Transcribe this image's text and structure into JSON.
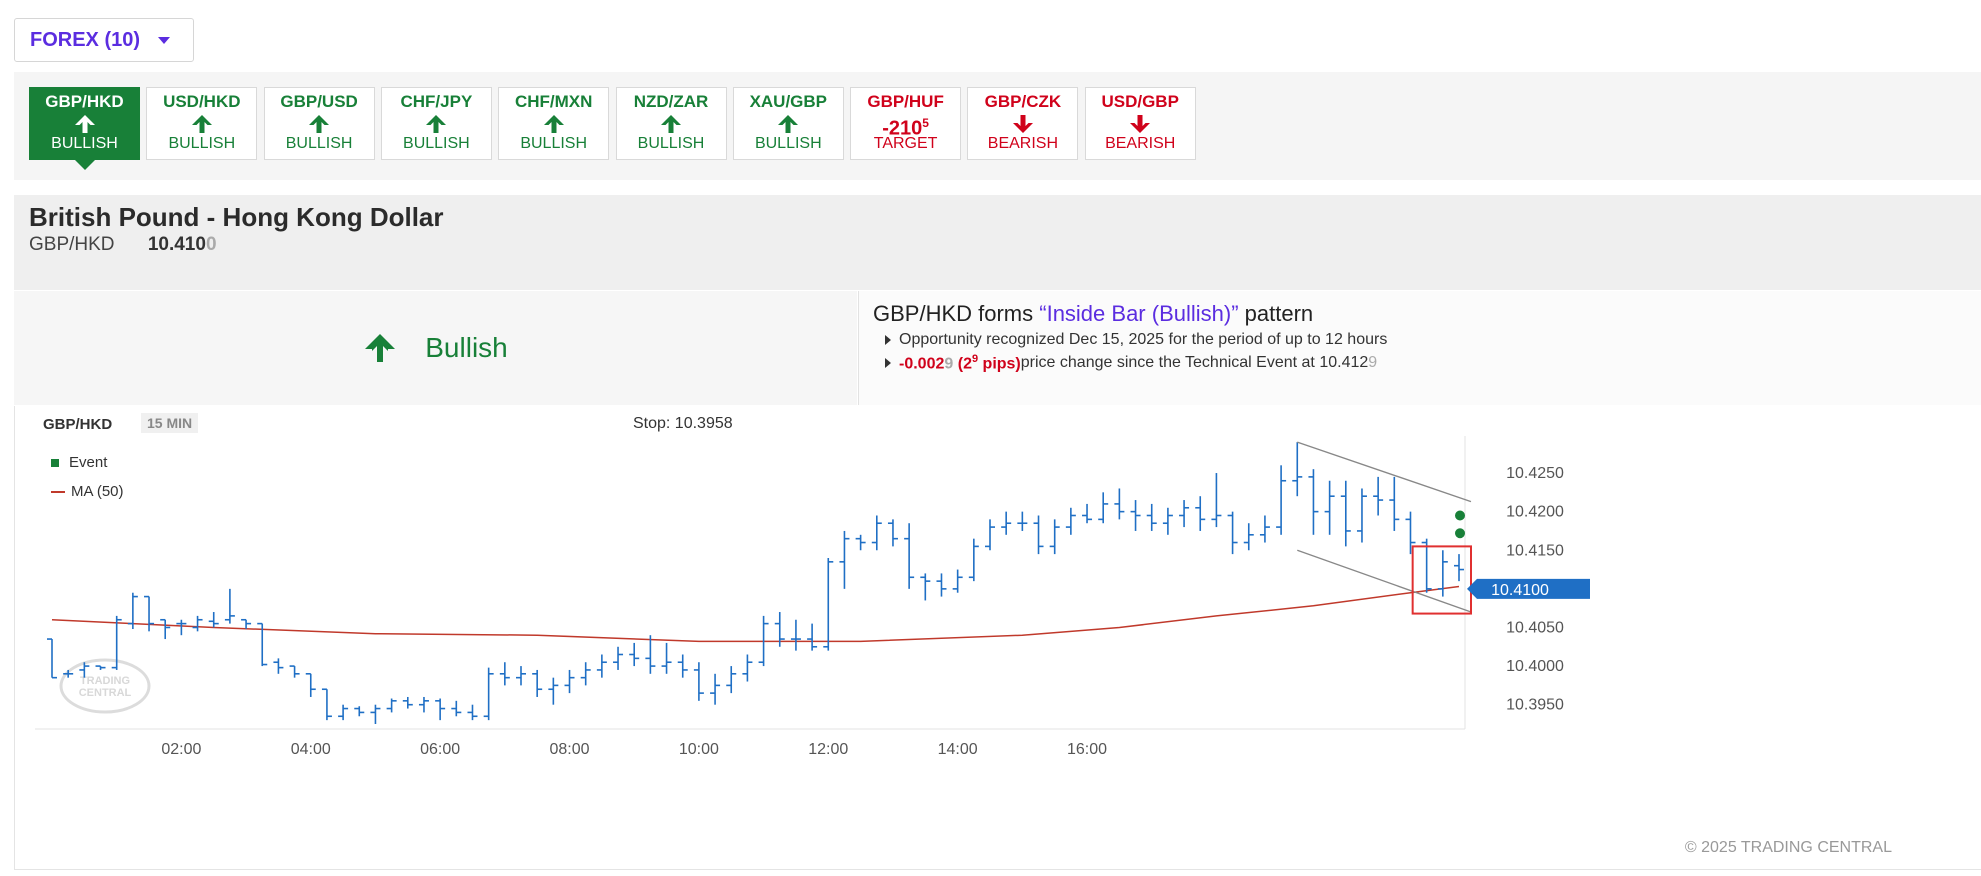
{
  "category": {
    "label": "FOREX (10)"
  },
  "tiles": [
    {
      "pair": "GBP/HKD",
      "kind": "up",
      "status": "BULLISH",
      "tone": "bull",
      "active": true
    },
    {
      "pair": "USD/HKD",
      "kind": "up",
      "status": "BULLISH",
      "tone": "bull",
      "active": false
    },
    {
      "pair": "GBP/USD",
      "kind": "up",
      "status": "BULLISH",
      "tone": "bull",
      "active": false
    },
    {
      "pair": "CHF/JPY",
      "kind": "up",
      "status": "BULLISH",
      "tone": "bull",
      "active": false
    },
    {
      "pair": "CHF/MXN",
      "kind": "up",
      "status": "BULLISH",
      "tone": "bull",
      "active": false
    },
    {
      "pair": "NZD/ZAR",
      "kind": "up",
      "status": "BULLISH",
      "tone": "bull",
      "active": false
    },
    {
      "pair": "XAU/GBP",
      "kind": "up",
      "status": "BULLISH",
      "tone": "bull",
      "active": false
    },
    {
      "pair": "GBP/HUF",
      "kind": "target",
      "value": "-210",
      "value_sup": "5",
      "status": "TARGET",
      "tone": "bear",
      "active": false
    },
    {
      "pair": "GBP/CZK",
      "kind": "down",
      "status": "BEARISH",
      "tone": "bear",
      "active": false
    },
    {
      "pair": "USD/GBP",
      "kind": "down",
      "status": "BEARISH",
      "tone": "bear",
      "active": false
    }
  ],
  "header": {
    "title": "British Pound - Hong Kong Dollar",
    "symbol": "GBP/HKD",
    "price_main": "10.410",
    "price_tail": "0"
  },
  "signal": {
    "label": "Bullish"
  },
  "event": {
    "pre": "GBP/HKD forms ",
    "pattern": "“Inside Bar (Bullish)”",
    "post": " pattern",
    "line1": "Opportunity recognized Dec 15, 2025 for the period of up to 12 hours",
    "change_main": "-0.002",
    "change_tail": "9",
    "pips_open": "(2",
    "pips_sup": "9",
    "pips_close": " pips)",
    "line2_mid": " price change since the Technical Event at 10.412",
    "line2_tail": "9"
  },
  "chart": {
    "symbol": "GBP/HKD",
    "timeframe": "15 MIN",
    "stop_label": "Stop: 10.3958",
    "legend": {
      "event": "Event",
      "ma": "MA (50)"
    },
    "current_price_label": "10.4100",
    "copyright": "© 2025 TRADING CENTRAL",
    "watermark": [
      "TRADING",
      "CENTRAL"
    ]
  },
  "chart_data": {
    "type": "bar",
    "subtype": "ohlc",
    "interval": "15 MIN",
    "x_ticks": [
      "02:00",
      "04:00",
      "06:00",
      "08:00",
      "10:00",
      "12:00",
      "14:00",
      "16:00"
    ],
    "y_ticks": [
      "10.4250",
      "10.4200",
      "10.4150",
      "10.4100",
      "10.4050",
      "10.4000",
      "10.3950"
    ],
    "ylim": [
      10.3925,
      10.4285
    ],
    "ohlc": [
      [
        10.4035,
        10.4035,
        10.3985,
        10.3985
      ],
      [
        10.399,
        10.3995,
        10.3985,
        10.399
      ],
      [
        10.3995,
        10.4005,
        10.3985,
        10.4
      ],
      [
        10.4,
        10.4,
        10.3995,
        10.3998
      ],
      [
        10.3998,
        10.4065,
        10.3995,
        10.406
      ],
      [
        10.4055,
        10.4095,
        10.4048,
        10.409
      ],
      [
        10.409,
        10.409,
        10.4045,
        10.4055
      ],
      [
        10.406,
        10.406,
        10.4035,
        10.405
      ],
      [
        10.4055,
        10.406,
        10.404,
        10.4055
      ],
      [
        10.405,
        10.4065,
        10.4045,
        10.406
      ],
      [
        10.4058,
        10.407,
        10.405,
        10.4055
      ],
      [
        10.406,
        10.41,
        10.4055,
        10.4065
      ],
      [
        10.406,
        10.406,
        10.4048,
        10.4055
      ],
      [
        10.4055,
        10.4055,
        10.4,
        10.4002
      ],
      [
        10.4005,
        10.401,
        10.399,
        10.3998
      ],
      [
        10.4,
        10.4,
        10.3985,
        10.399
      ],
      [
        10.399,
        10.399,
        10.396,
        10.397
      ],
      [
        10.397,
        10.397,
        10.393,
        10.3935
      ],
      [
        10.3935,
        10.395,
        10.393,
        10.3945
      ],
      [
        10.3945,
        10.3948,
        10.3935,
        10.394
      ],
      [
        10.394,
        10.395,
        10.3925,
        10.3945
      ],
      [
        10.3945,
        10.3958,
        10.394,
        10.3955
      ],
      [
        10.3955,
        10.396,
        10.3945,
        10.395
      ],
      [
        10.395,
        10.396,
        10.394,
        10.3955
      ],
      [
        10.3955,
        10.3958,
        10.393,
        10.3945
      ],
      [
        10.3945,
        10.3955,
        10.3935,
        10.394
      ],
      [
        10.394,
        10.395,
        10.393,
        10.3935
      ],
      [
        10.3935,
        10.3998,
        10.393,
        10.399
      ],
      [
        10.399,
        10.4005,
        10.3975,
        10.3985
      ],
      [
        10.3985,
        10.4,
        10.3975,
        10.399
      ],
      [
        10.399,
        10.3995,
        10.396,
        10.397
      ],
      [
        10.397,
        10.3985,
        10.395,
        10.3975
      ],
      [
        10.3975,
        10.3995,
        10.3965,
        10.3985
      ],
      [
        10.3985,
        10.4005,
        10.3975,
        10.3995
      ],
      [
        10.3995,
        10.4015,
        10.3985,
        10.4005
      ],
      [
        10.4005,
        10.4025,
        10.3995,
        10.4015
      ],
      [
        10.4015,
        10.403,
        10.4,
        10.401
      ],
      [
        10.401,
        10.404,
        10.399,
        10.4
      ],
      [
        10.4,
        10.403,
        10.399,
        10.4005
      ],
      [
        10.4005,
        10.4015,
        10.3985,
        10.3995
      ],
      [
        10.3995,
        10.4005,
        10.3955,
        10.3965
      ],
      [
        10.3965,
        10.399,
        10.395,
        10.3975
      ],
      [
        10.3975,
        10.4,
        10.3965,
        10.399
      ],
      [
        10.399,
        10.4015,
        10.398,
        10.4005
      ],
      [
        10.4005,
        10.4065,
        10.4,
        10.4055
      ],
      [
        10.4055,
        10.407,
        10.4025,
        10.4035
      ],
      [
        10.4035,
        10.406,
        10.402,
        10.4035
      ],
      [
        10.4035,
        10.4055,
        10.402,
        10.4025
      ],
      [
        10.4025,
        10.414,
        10.402,
        10.4135
      ],
      [
        10.4135,
        10.4175,
        10.41,
        10.4165
      ],
      [
        10.4165,
        10.417,
        10.415,
        10.416
      ],
      [
        10.416,
        10.4195,
        10.415,
        10.4185
      ],
      [
        10.4185,
        10.419,
        10.4155,
        10.4165
      ],
      [
        10.4165,
        10.4185,
        10.41,
        10.4115
      ],
      [
        10.4115,
        10.412,
        10.4085,
        10.411
      ],
      [
        10.411,
        10.412,
        10.409,
        10.41
      ],
      [
        10.41,
        10.4125,
        10.4095,
        10.4115
      ],
      [
        10.4115,
        10.4165,
        10.411,
        10.4155
      ],
      [
        10.4155,
        10.419,
        10.415,
        10.418
      ],
      [
        10.418,
        10.42,
        10.417,
        10.4185
      ],
      [
        10.4185,
        10.42,
        10.4175,
        10.4185
      ],
      [
        10.4185,
        10.4195,
        10.4145,
        10.4155
      ],
      [
        10.4155,
        10.419,
        10.4145,
        10.418
      ],
      [
        10.418,
        10.4205,
        10.417,
        10.4195
      ],
      [
        10.4195,
        10.421,
        10.4185,
        10.419
      ],
      [
        10.419,
        10.4225,
        10.4185,
        10.421
      ],
      [
        10.421,
        10.423,
        10.419,
        10.42
      ],
      [
        10.42,
        10.4215,
        10.4175,
        10.4195
      ],
      [
        10.4195,
        10.421,
        10.4175,
        10.4185
      ],
      [
        10.4185,
        10.4205,
        10.417,
        10.4195
      ],
      [
        10.4195,
        10.4215,
        10.418,
        10.4205
      ],
      [
        10.4205,
        10.422,
        10.4175,
        10.419
      ],
      [
        10.419,
        10.425,
        10.418,
        10.4195
      ],
      [
        10.4195,
        10.42,
        10.4145,
        10.416
      ],
      [
        10.416,
        10.4185,
        10.415,
        10.417
      ],
      [
        10.417,
        10.4195,
        10.416,
        10.418
      ],
      [
        10.418,
        10.426,
        10.417,
        10.424
      ],
      [
        10.424,
        10.429,
        10.422,
        10.4245
      ],
      [
        10.4245,
        10.4255,
        10.417,
        10.42
      ],
      [
        10.42,
        10.424,
        10.417,
        10.422
      ],
      [
        10.422,
        10.424,
        10.4155,
        10.4175
      ],
      [
        10.4175,
        10.423,
        10.416,
        10.422
      ],
      [
        10.422,
        10.4245,
        10.4195,
        10.4215
      ],
      [
        10.4215,
        10.4245,
        10.4175,
        10.419
      ],
      [
        10.419,
        10.42,
        10.4145,
        10.416
      ],
      [
        10.416,
        10.4165,
        10.4095,
        10.41
      ],
      [
        10.41,
        10.415,
        10.409,
        10.4135
      ],
      [
        10.413,
        10.4145,
        10.411,
        10.4125
      ]
    ],
    "ma50_anchors": [
      [
        0,
        10.406
      ],
      [
        5,
        10.4055
      ],
      [
        10,
        10.405
      ],
      [
        20,
        10.4042
      ],
      [
        30,
        10.404
      ],
      [
        40,
        10.4032
      ],
      [
        50,
        10.4032
      ],
      [
        60,
        10.404
      ],
      [
        66,
        10.405
      ],
      [
        72,
        10.4065
      ],
      [
        78,
        10.4078
      ],
      [
        84,
        10.4095
      ],
      [
        87,
        10.4103
      ]
    ],
    "channel": {
      "upper": [
        [
          77,
          10.429
        ],
        [
          87,
          10.4213
        ]
      ],
      "lower": [
        [
          77,
          10.415
        ],
        [
          87,
          10.407
        ]
      ]
    },
    "event_markers": [
      10.4195,
      10.4172
    ],
    "highlight_bars": [
      85,
      87
    ],
    "colors": {
      "bar": "#1f6fc5",
      "ma": "#c0392b",
      "channel": "#888888",
      "event": "#188038",
      "highlight": "#e03030",
      "price_tag": "#1f6fc5"
    }
  }
}
